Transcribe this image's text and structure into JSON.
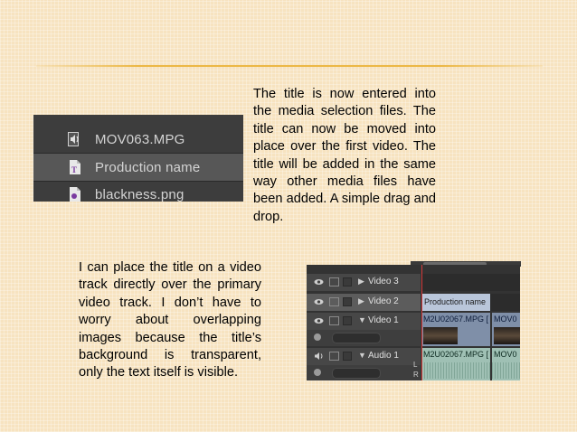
{
  "slide": {
    "paragraph_1": "The title is now entered into the media selection files. The title can now be moved into place over the first video. The title will be added in the same way other media files have been added. A simple drag and drop.",
    "paragraph_2": "I can place the title on a video track directly over the primary video track. I don’t have to worry about overlapping images because the title’s background is transparent, only the text itself is visible."
  },
  "media_panel": {
    "items": [
      {
        "label": "MOV063.MPG",
        "icon": "audio-video-file-icon",
        "selected": false
      },
      {
        "label": "Production name",
        "icon": "title-file-icon",
        "selected": true
      },
      {
        "label": "blackness.png",
        "icon": "image-file-icon",
        "selected": false
      }
    ]
  },
  "timeline": {
    "tracks": [
      {
        "name": "Video 3",
        "expanded": false
      },
      {
        "name": "Video 2",
        "expanded": false
      },
      {
        "name": "Video 1",
        "expanded": true
      },
      {
        "name": "Audio 1",
        "expanded": true
      }
    ],
    "clips": {
      "title_clip": "Production name",
      "video_clip_1": "M2U02067.MPG [",
      "video_clip_2": "MOV0",
      "audio_clip_1": "M2U02067.MPG [",
      "audio_clip_2": "MOV0"
    },
    "audio_channel_labels": [
      "L",
      "R"
    ]
  },
  "colors": {
    "background": "#f7e3c0",
    "accent_rule": "#ecb846",
    "panel_bg": "#3d3d3d",
    "selected_row": "#575757",
    "title_clip": "#b9c6da",
    "video_clip": "#7f8fa8",
    "audio_clip": "#9fc0b4",
    "playhead": "#d43b3b"
  }
}
